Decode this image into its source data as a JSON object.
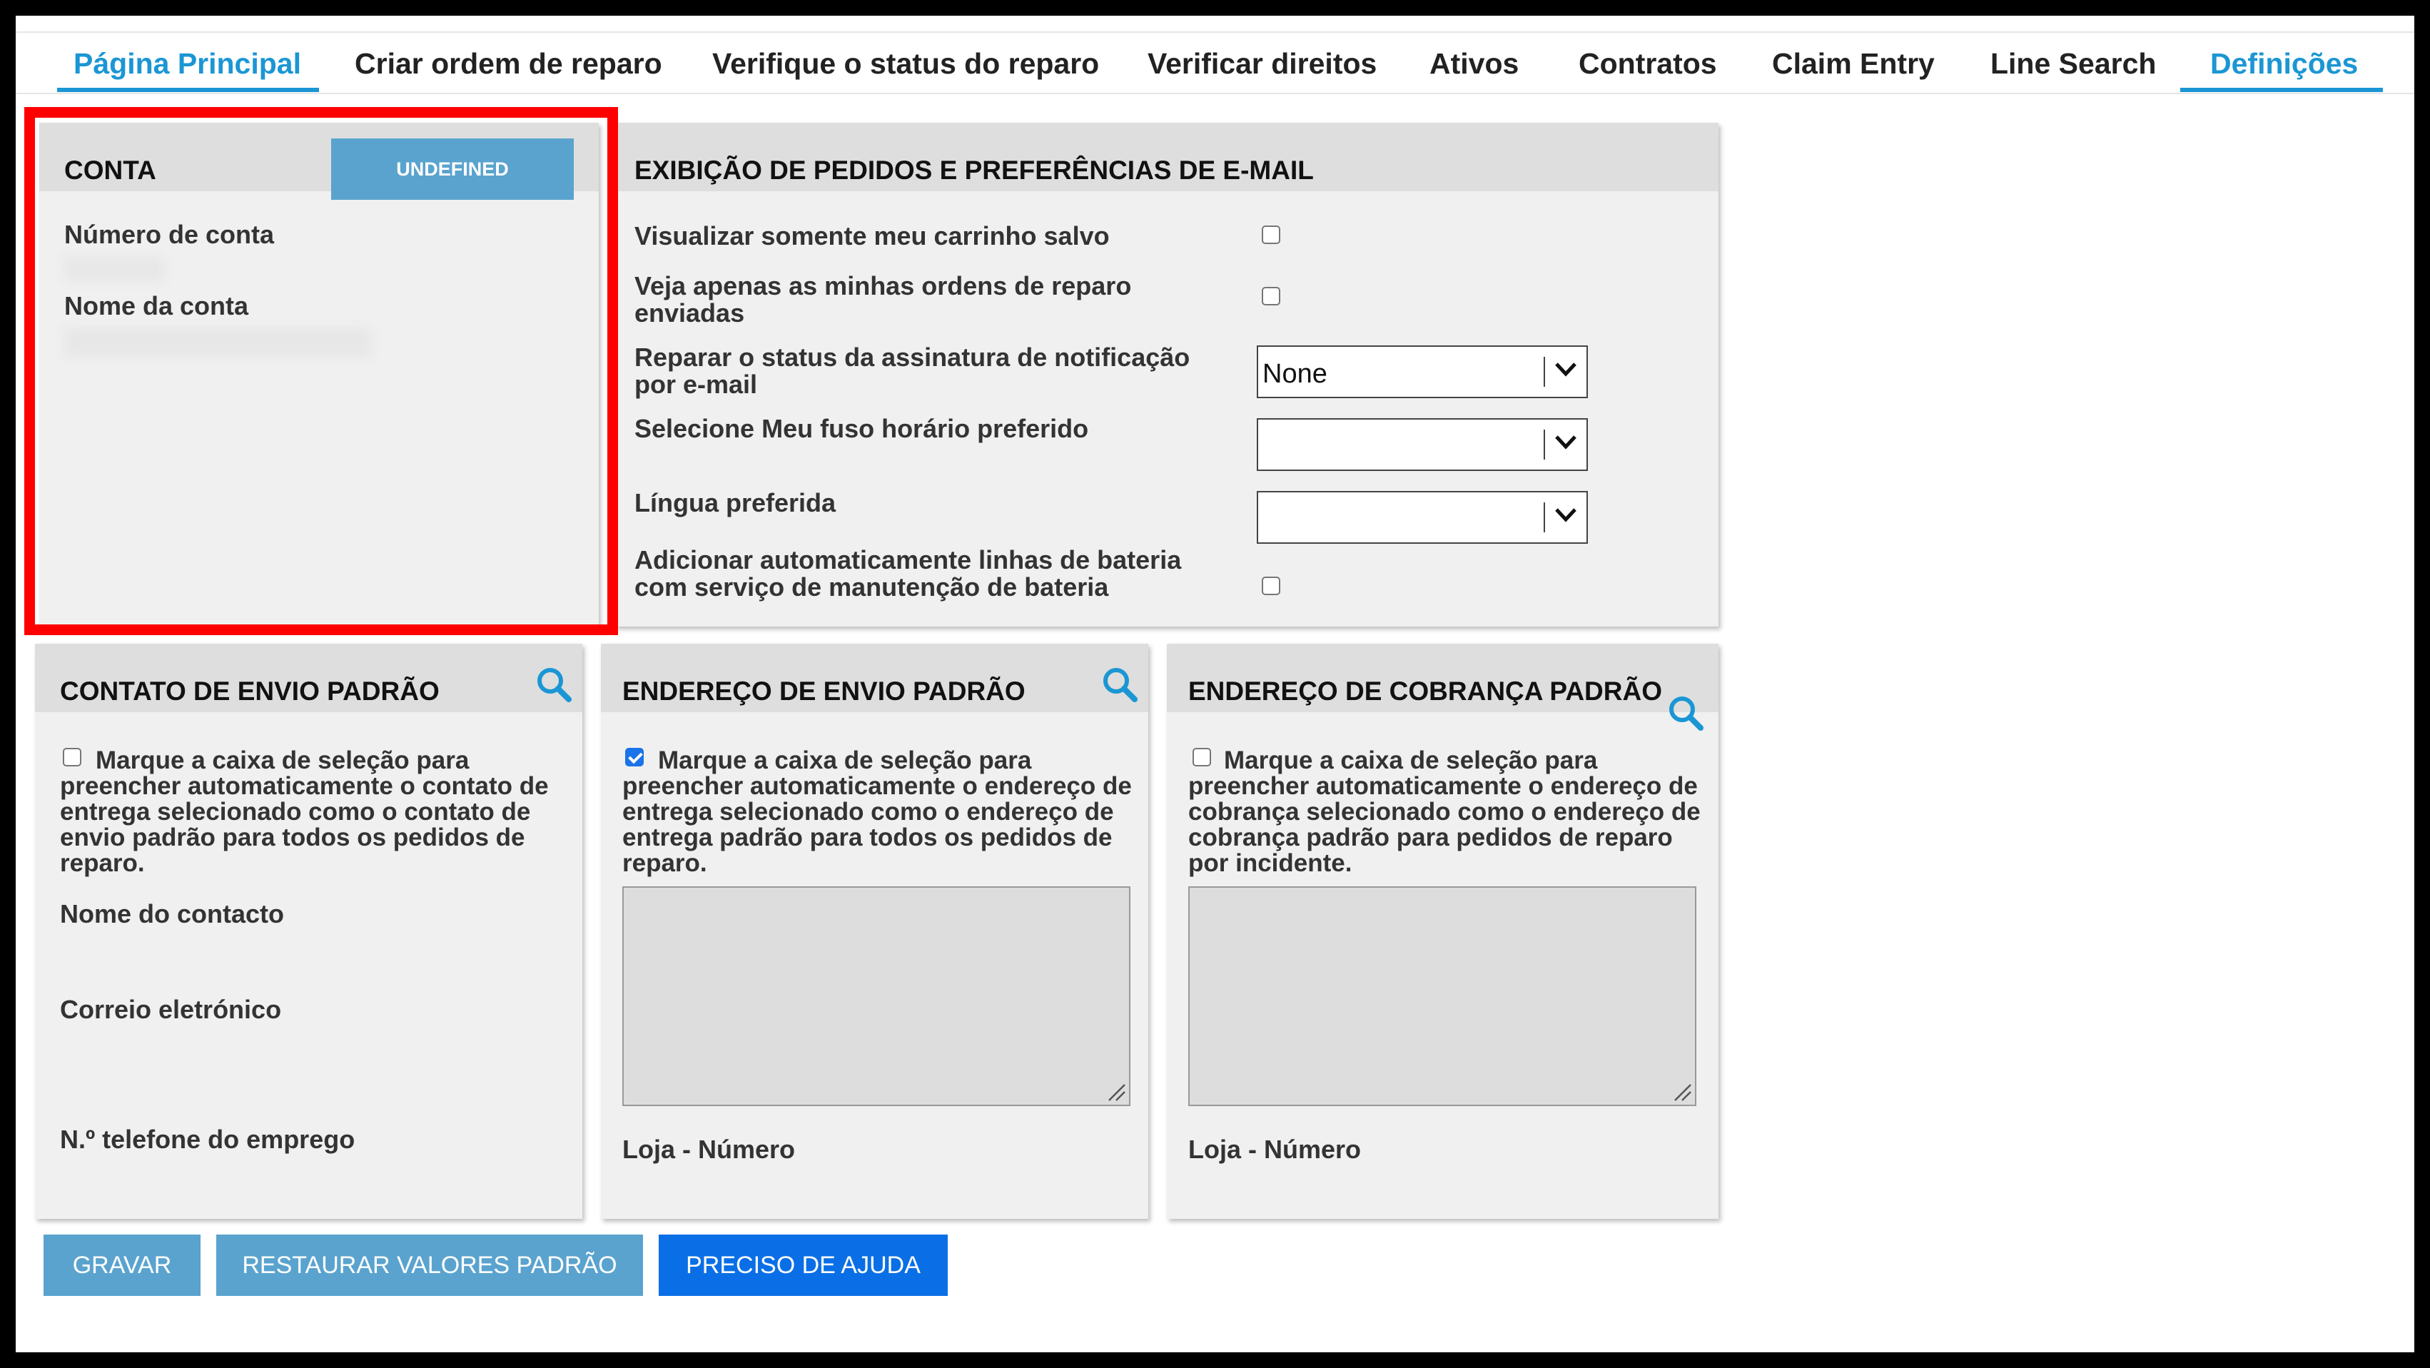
{
  "nav": {
    "tabs": [
      {
        "label": "Página Principal",
        "active": true
      },
      {
        "label": "Criar ordem de reparo",
        "active": false
      },
      {
        "label": "Verifique o status do reparo",
        "active": false
      },
      {
        "label": "Verificar direitos",
        "active": false
      },
      {
        "label": "Ativos",
        "active": false
      },
      {
        "label": "Contratos",
        "active": false
      },
      {
        "label": "Claim Entry",
        "active": false
      },
      {
        "label": "Line Search",
        "active": false
      },
      {
        "label": "Definições",
        "active": true
      }
    ]
  },
  "account": {
    "title": "CONTA",
    "button_label": "UNDEFINED",
    "number_label": "Número de conta",
    "name_label": "Nome da conta"
  },
  "prefs": {
    "title": "EXIBIÇÃO DE PEDIDOS E PREFERÊNCIAS DE E-MAIL",
    "saved_cart_label": "Visualizar somente meu carrinho salvo",
    "saved_cart_checked": false,
    "my_orders_label": "Veja apenas as minhas ordens de reparo enviadas",
    "my_orders_checked": false,
    "email_status_label": "Reparar o status da assinatura de notificação por e-mail",
    "email_status_value": "None",
    "timezone_label": "Selecione Meu fuso horário preferido",
    "timezone_value": "",
    "language_label": "Língua preferida",
    "language_value": "",
    "battery_label": "Adicionar automaticamente linhas de bateria com serviço de manutenção de bateria",
    "battery_checked": false
  },
  "shipping_contact": {
    "title": "CONTATO DE ENVIO PADRÃO",
    "checkbox_text": "Marque a caixa de seleção para preencher automaticamente o contato de entrega selecionado como o contato de envio padrão para todos os pedidos de reparo.",
    "checked": false,
    "name_label": "Nome do contacto",
    "email_label": "Correio eletrónico",
    "phone_label": "N.º telefone do emprego"
  },
  "shipping_address": {
    "title": "ENDEREÇO DE ENVIO PADRÃO",
    "checkbox_text": "Marque a caixa de seleção para preencher automaticamente o endereço de entrega selecionado como o endereço de entrega padrão para todos os pedidos de reparo.",
    "checked": true,
    "store_label": "Loja - Número"
  },
  "billing_address": {
    "title": "ENDEREÇO DE COBRANÇA PADRÃO",
    "checkbox_text": "Marque a caixa de seleção para preencher automaticamente o endereço de cobrança selecionado como o endereço de cobrança padrão para pedidos de reparo por incidente.",
    "checked": false,
    "store_label": "Loja - Número"
  },
  "actions": {
    "save_label": "GRAVAR",
    "restore_label": "RESTAURAR VALORES PADRÃO",
    "help_label": "PRECISO DE AJUDA"
  },
  "colors": {
    "accent": "#1b96d4",
    "button_muted": "#5aa3cf",
    "button_primary": "#0a6fe6",
    "highlight": "#ff0000",
    "panel_bg": "#f0f0f0",
    "panel_header": "#dedede"
  },
  "icons": [
    "search-icon",
    "chevron-down-icon",
    "resize-grip-icon"
  ]
}
